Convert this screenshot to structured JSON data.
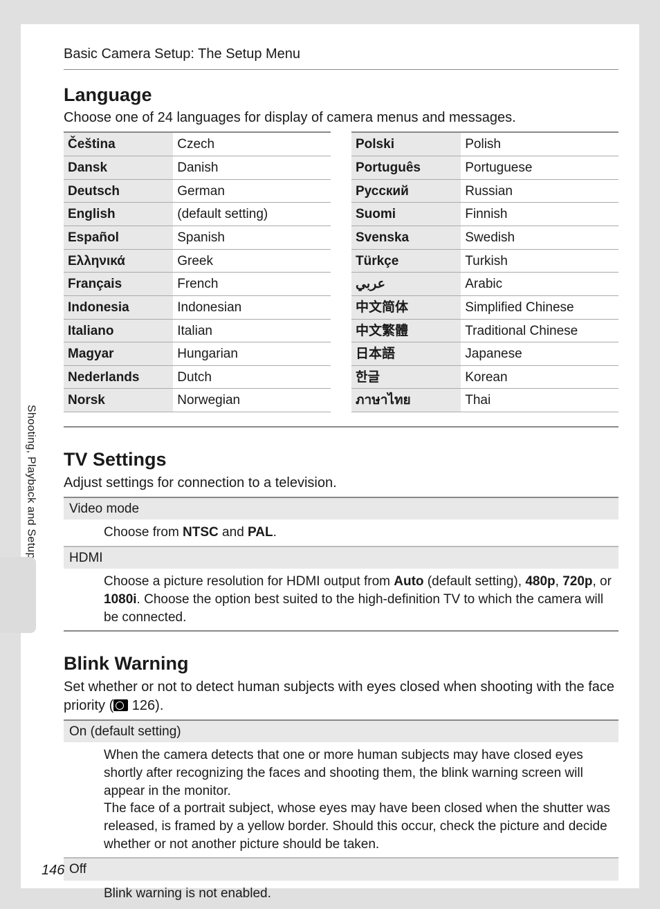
{
  "header": "Basic Camera Setup: The Setup Menu",
  "side_tab": "Shooting, Playback and Setup Menus",
  "page_number": "146",
  "section_language": {
    "title": "Language",
    "intro": "Choose one of 24 languages for display of camera menus and messages.",
    "left": [
      {
        "native": "Čeština",
        "english": "Czech"
      },
      {
        "native": "Dansk",
        "english": "Danish"
      },
      {
        "native": "Deutsch",
        "english": "German"
      },
      {
        "native": "English",
        "english": "(default setting)"
      },
      {
        "native": "Español",
        "english": "Spanish"
      },
      {
        "native": "Ελληνικά",
        "english": "Greek"
      },
      {
        "native": "Français",
        "english": "French"
      },
      {
        "native": "Indonesia",
        "english": "Indonesian"
      },
      {
        "native": "Italiano",
        "english": "Italian"
      },
      {
        "native": "Magyar",
        "english": "Hungarian"
      },
      {
        "native": "Nederlands",
        "english": "Dutch"
      },
      {
        "native": "Norsk",
        "english": "Norwegian"
      }
    ],
    "right": [
      {
        "native": "Polski",
        "english": "Polish"
      },
      {
        "native": "Português",
        "english": "Portuguese"
      },
      {
        "native": "Русский",
        "english": "Russian"
      },
      {
        "native": "Suomi",
        "english": "Finnish"
      },
      {
        "native": "Svenska",
        "english": "Swedish"
      },
      {
        "native": "Türkçe",
        "english": "Turkish"
      },
      {
        "native": "عربي",
        "english": "Arabic"
      },
      {
        "native": "中文简体",
        "english": "Simplified Chinese"
      },
      {
        "native": "中文繁體",
        "english": "Traditional Chinese"
      },
      {
        "native": "日本語",
        "english": "Japanese"
      },
      {
        "native": "한글",
        "english": "Korean"
      },
      {
        "native": "ภาษาไทย",
        "english": "Thai"
      }
    ]
  },
  "section_tv": {
    "title": "TV Settings",
    "intro": "Adjust settings for connection to a television.",
    "video_mode": {
      "label": "Video mode",
      "desc_pre": "Choose from ",
      "opt1": "NTSC",
      "mid": " and ",
      "opt2": "PAL",
      "post": "."
    },
    "hdmi": {
      "label": "HDMI",
      "t1": "Choose a picture resolution for HDMI output from ",
      "b1": "Auto",
      "t2": " (default setting), ",
      "b2": "480p",
      "t3": ", ",
      "b3": "720p",
      "t4": ", or ",
      "b4": "1080i",
      "t5": ". Choose the option best suited to the high-definition TV to which the camera will be connected."
    }
  },
  "section_blink": {
    "title": "Blink Warning",
    "intro_pre": "Set whether or not to detect human subjects with eyes closed when shooting with the face priority (",
    "intro_ref": " 126).",
    "on": {
      "label": "On (default setting)",
      "p1": "When the camera detects that one or more human subjects may have closed eyes shortly after recognizing the faces and shooting them, the blink warning screen will appear in the monitor.",
      "p2": "The face of a portrait subject, whose eyes may have been closed when the shutter was released, is framed by a yellow border. Should this occur, check the picture and decide whether or not another picture should be taken."
    },
    "off": {
      "label": "Off",
      "desc": "Blink warning is not enabled."
    }
  }
}
